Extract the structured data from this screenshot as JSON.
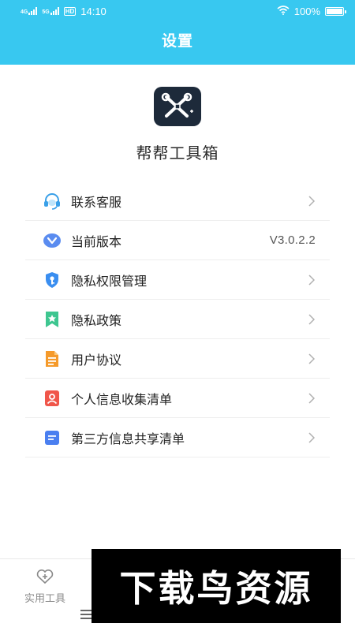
{
  "status_bar": {
    "net1": "4G",
    "net2": "5G",
    "hd": "HD",
    "time": "14:10",
    "battery": "100%"
  },
  "header": {
    "title": "设置"
  },
  "app": {
    "name": "帮帮工具箱"
  },
  "settings": {
    "items": [
      {
        "label": "联系客服",
        "icon": "headset-icon"
      },
      {
        "label": "当前版本",
        "icon": "version-icon",
        "value": "V3.0.2.2"
      },
      {
        "label": "隐私权限管理",
        "icon": "shield-key-icon"
      },
      {
        "label": "隐私政策",
        "icon": "bookmark-star-icon"
      },
      {
        "label": "用户协议",
        "icon": "document-icon"
      },
      {
        "label": "个人信息收集清单",
        "icon": "person-card-icon"
      },
      {
        "label": "第三方信息共享清单",
        "icon": "list-card-icon"
      }
    ]
  },
  "tabbar": {
    "tools_label": "实用工具"
  },
  "watermark": {
    "text": "下载鸟资源"
  },
  "colors": {
    "header_bg": "#38c8f0",
    "headset": "#3aa0e8",
    "version": "#5a8cf0",
    "shield": "#3a8ef0",
    "bookmark": "#3ec690",
    "document": "#f59a2a",
    "person": "#f0564a",
    "list": "#4a7ff0"
  }
}
